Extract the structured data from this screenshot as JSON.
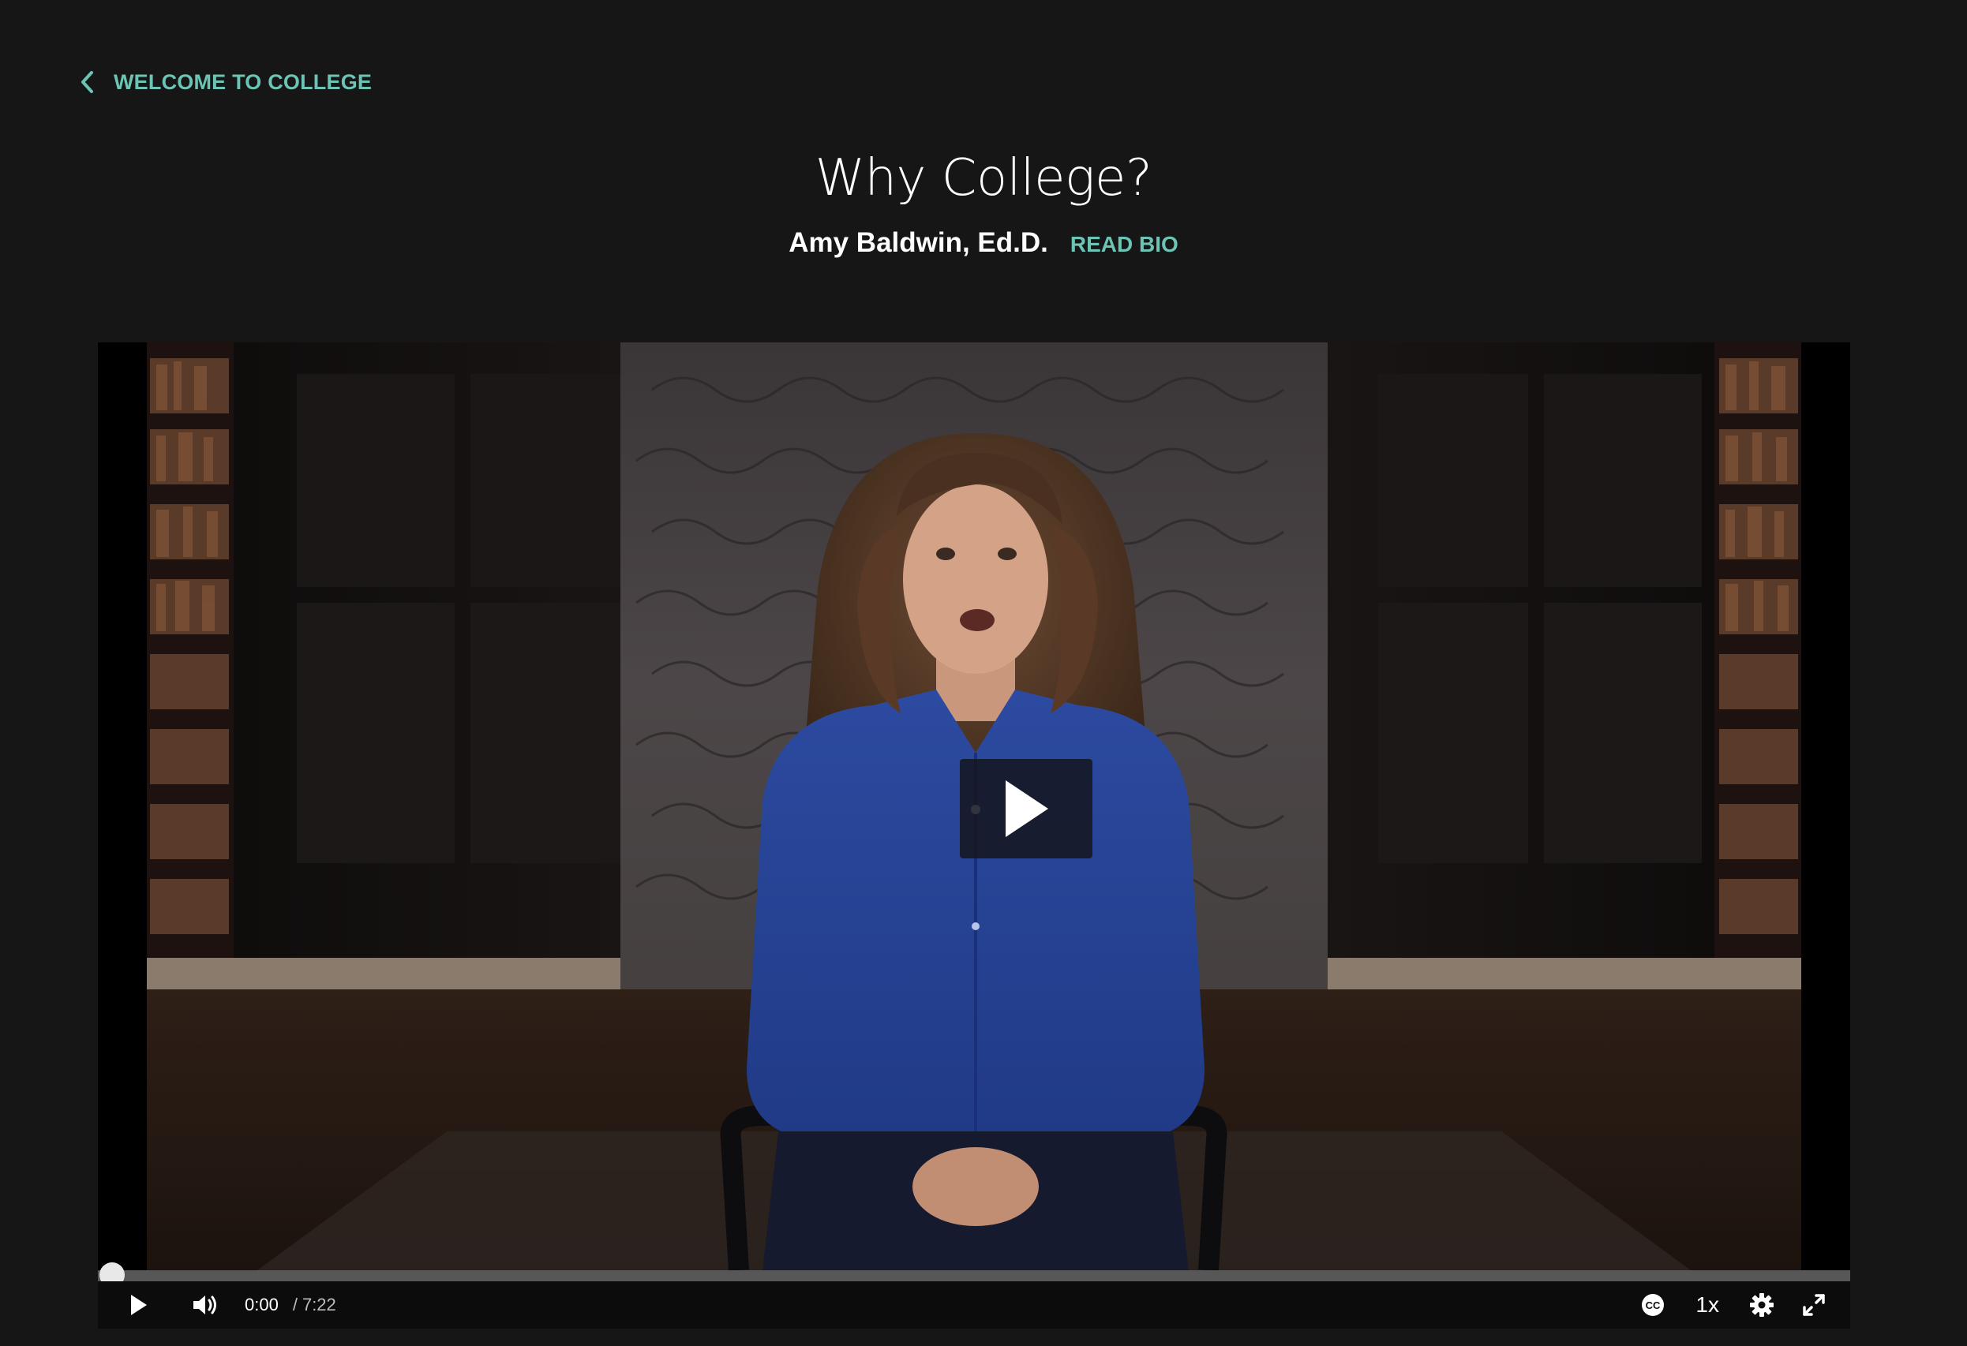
{
  "breadcrumb": {
    "back_label": "WELCOME TO COLLEGE",
    "icon": "chevron-left-icon"
  },
  "lesson": {
    "title": "Why College?",
    "author": "Amy Baldwin, Ed.D.",
    "read_bio_label": "READ BIO"
  },
  "player": {
    "current_time": "0:00",
    "separator": "/",
    "duration": "7:22",
    "progress": 0,
    "playback_speed": "1x",
    "icons": {
      "big_play": "play-icon",
      "play": "play-icon",
      "volume": "volume-icon",
      "captions": "closed-captions-icon",
      "settings": "gear-icon",
      "fullscreen": "fullscreen-icon"
    }
  },
  "colors": {
    "background": "#161616",
    "accent": "#6cc4b4",
    "text": "#ffffff"
  }
}
